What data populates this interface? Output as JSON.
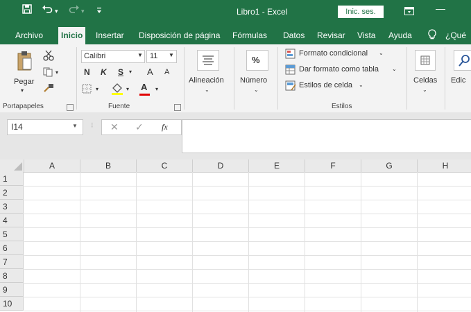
{
  "window": {
    "title": "Libro1 - Excel",
    "signin_label": "Inic. ses."
  },
  "quick_access": {
    "save_icon": "save-icon",
    "undo_icon": "undo-icon",
    "redo_icon": "redo-icon",
    "customize_icon": "customize-qat-icon"
  },
  "tabs": [
    "Archivo",
    "Inicio",
    "Insertar",
    "Disposición de página",
    "Fórmulas",
    "Datos",
    "Revisar",
    "Vista",
    "Ayuda",
    "¿Qué"
  ],
  "ribbon": {
    "clipboard": {
      "paste": "Pegar",
      "group": "Portapapeles"
    },
    "font": {
      "name": "Calibri",
      "size": "11",
      "bold": "N",
      "italic": "K",
      "underline": "S",
      "grow": "A",
      "shrink": "A",
      "color_letter": "A",
      "group": "Fuente"
    },
    "alignment": {
      "label": "Alineación"
    },
    "number": {
      "symbol": "%",
      "label": "Número"
    },
    "styles": {
      "conditional": "Formato condicional",
      "table": "Dar formato como tabla",
      "cell": "Estilos de celda",
      "group": "Estilos"
    },
    "cells": {
      "label": "Celdas"
    },
    "editing": {
      "label": "Edic"
    }
  },
  "formula_bar": {
    "name_box": "I14",
    "cancel": "✕",
    "enter": "✓",
    "fx": "fx",
    "value": ""
  },
  "grid": {
    "columns": [
      "A",
      "B",
      "C",
      "D",
      "E",
      "F",
      "G",
      "H"
    ],
    "rows": [
      "1",
      "2",
      "3",
      "4",
      "5",
      "6",
      "7",
      "8",
      "9",
      "10"
    ]
  },
  "colors": {
    "accent": "#217346",
    "font_color_bar": "#e00000"
  }
}
